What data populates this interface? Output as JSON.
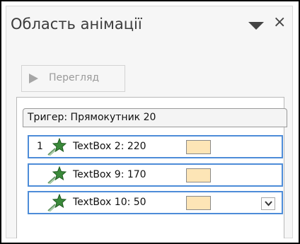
{
  "pane": {
    "title": "Область анімації",
    "menu_icon": "dropdown-triangle-icon",
    "close_icon": "close-icon",
    "close_glyph": "×"
  },
  "toolbar": {
    "play_icon": "play-icon",
    "play_label": "Перегляд"
  },
  "animation_list": {
    "trigger_label": "Тригер: Прямокутник 20",
    "items": [
      {
        "number": "1",
        "label": "TextBox 2: 220",
        "icon": "emphasis-star-icon",
        "timing_color": "#fde5b6",
        "has_dropdown": false
      },
      {
        "number": "",
        "label": "TextBox 9: 170",
        "icon": "emphasis-star-icon",
        "timing_color": "#fde5b6",
        "has_dropdown": false
      },
      {
        "number": "",
        "label": "TextBox 10: 50",
        "icon": "emphasis-star-icon",
        "timing_color": "#fde5b6",
        "has_dropdown": true
      }
    ]
  },
  "colors": {
    "selection_border": "#4d8cd8",
    "timing_bar": "#fde5b6",
    "star_green": "#3a8a3a"
  }
}
